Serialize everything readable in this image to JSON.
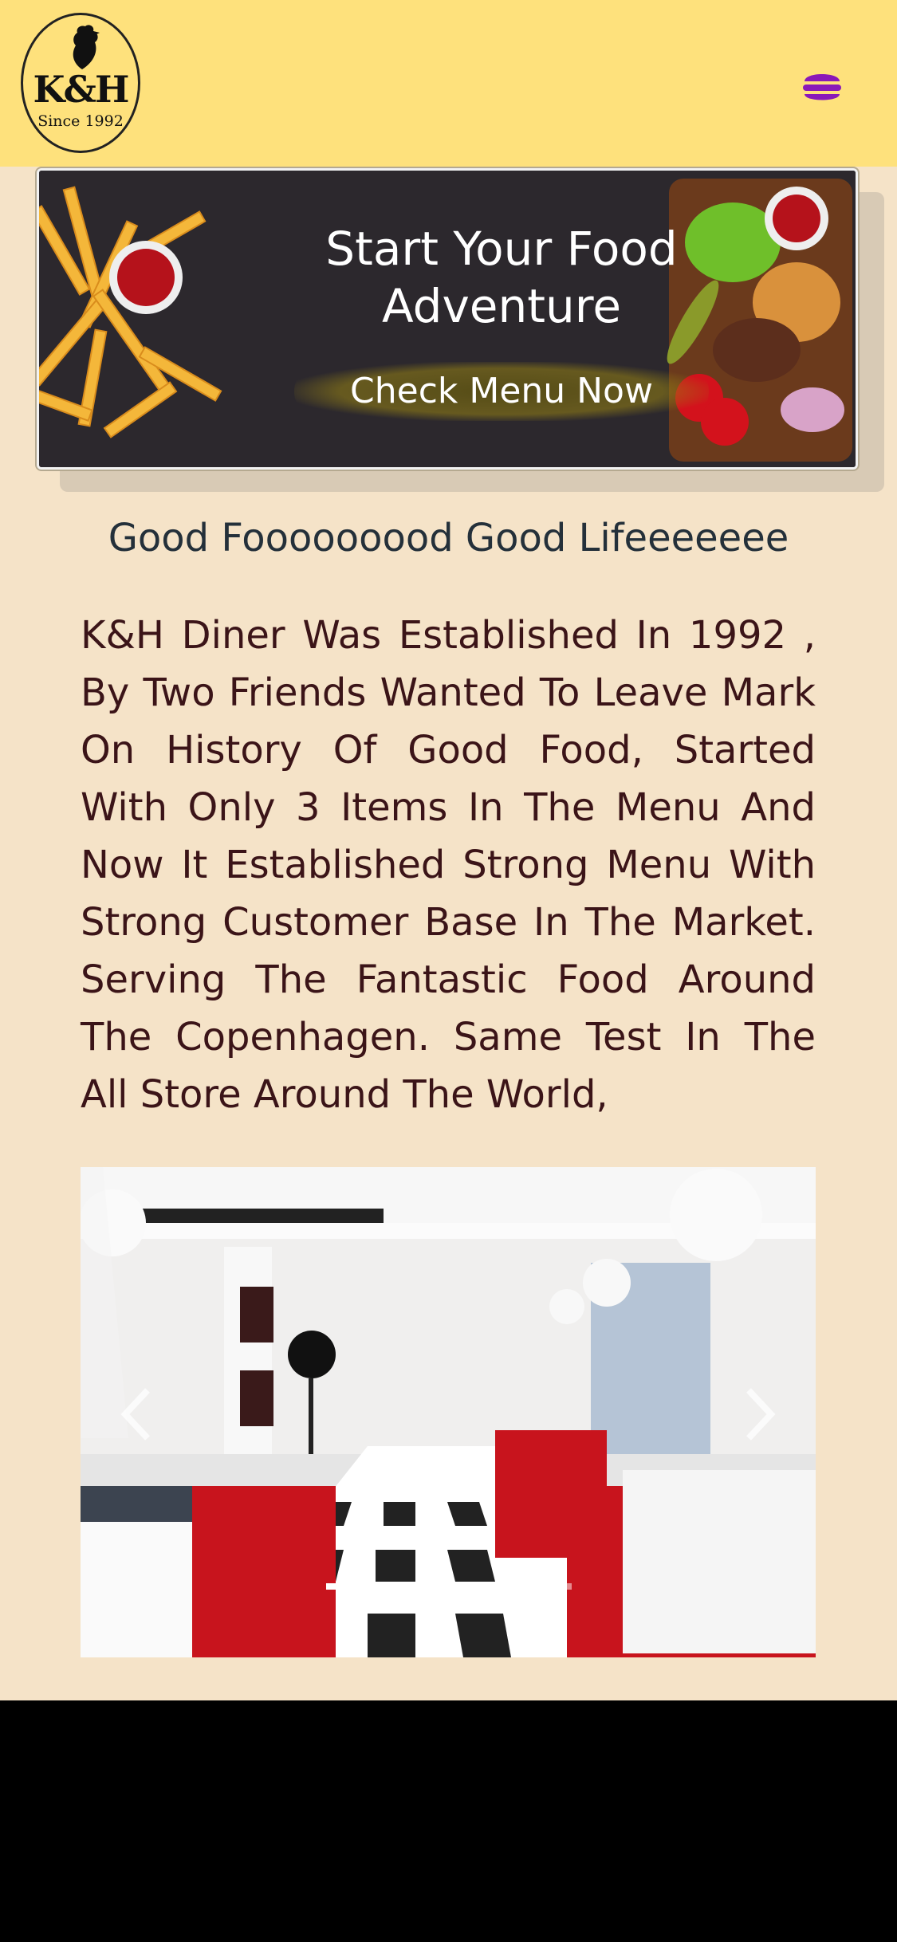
{
  "header": {
    "logo_main": "K&H",
    "logo_sub": "Since 1992",
    "menu_icon": "hamburger-icon",
    "menu_color": "#8a18b8",
    "background": "#fee17c"
  },
  "banner": {
    "title_line1": "Start Your Food",
    "title_line2": "Adventure",
    "cta": "Check Menu Now"
  },
  "tagline": "Good Fooooooood Good Lifeeeeeee",
  "about": "K&H Diner Was Established In 1992 , By Two Friends Wanted To Leave Mark On History Of Good Food, Started With Only 3 Items In The Menu And Now It Established Strong Menu With Strong Customer Base In The Market. Serving The Fantastic Food Around The Copenhagen. Same Test In The All Store Around The World,",
  "carousel": {
    "prev_icon": "chevron-left-icon",
    "next_icon": "chevron-right-icon",
    "slide_count": 3,
    "active_index": 0
  },
  "colors": {
    "page_bg": "#f5e3c8",
    "text": "#3b1418",
    "tagline": "#24303a"
  }
}
